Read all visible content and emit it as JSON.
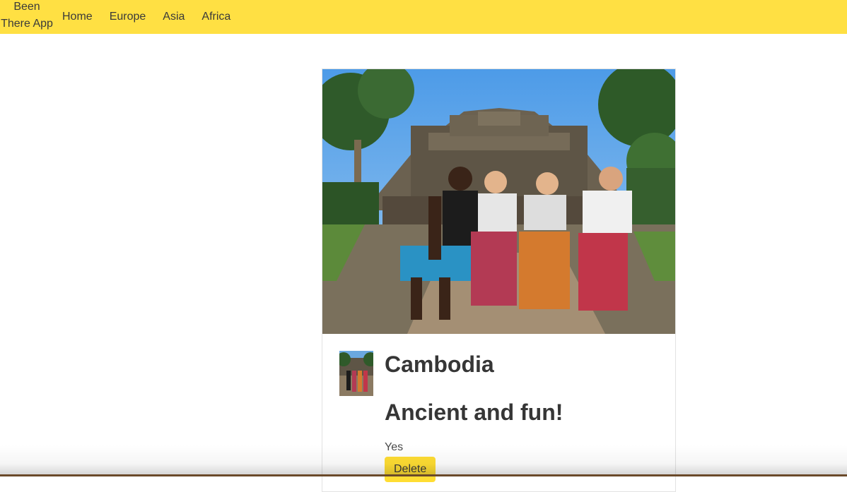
{
  "navbar": {
    "brand": "Been There App",
    "links": [
      "Home",
      "Europe",
      "Asia",
      "Africa"
    ],
    "background": "#ffe043"
  },
  "card": {
    "hero_image": "photo-group-at-temple",
    "thumbnail": "photo-thumbnail",
    "title": "Cambodia",
    "description": "Ancient and fun!",
    "visited": "Yes",
    "delete_label": "Delete"
  }
}
